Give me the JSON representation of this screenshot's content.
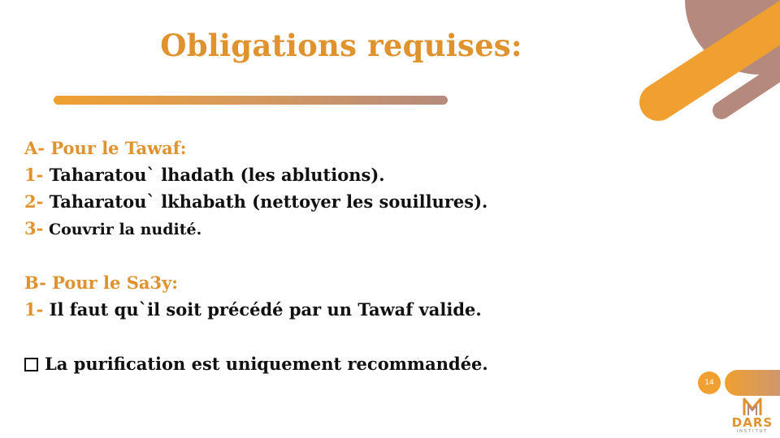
{
  "slide": {
    "title": "Obligations requises:",
    "section_a": {
      "heading": "A- Pour le Tawaf:",
      "items": [
        {
          "num": "1-",
          "text": " Taharatou` lhadath (les ablutions)."
        },
        {
          "num": "2-",
          "text": " Taharatou` lkhabath (nettoyer les souillures)."
        },
        {
          "num": "3-",
          "text": " Couvrir la nudité."
        }
      ]
    },
    "section_b": {
      "heading": "B- Pour le Sa3y:",
      "items": [
        {
          "num": "1-",
          "text": " Il faut qu`il soit précédé par un Tawaf valide."
        }
      ]
    },
    "note": "La purification est uniquement recommandée.",
    "page_number": "14"
  },
  "logo": {
    "name": "DARS",
    "subtitle": "INSTITUT"
  },
  "colors": {
    "accent_orange": "#e0922e",
    "accent_mauve": "#b58a7d",
    "text": "#111111"
  }
}
